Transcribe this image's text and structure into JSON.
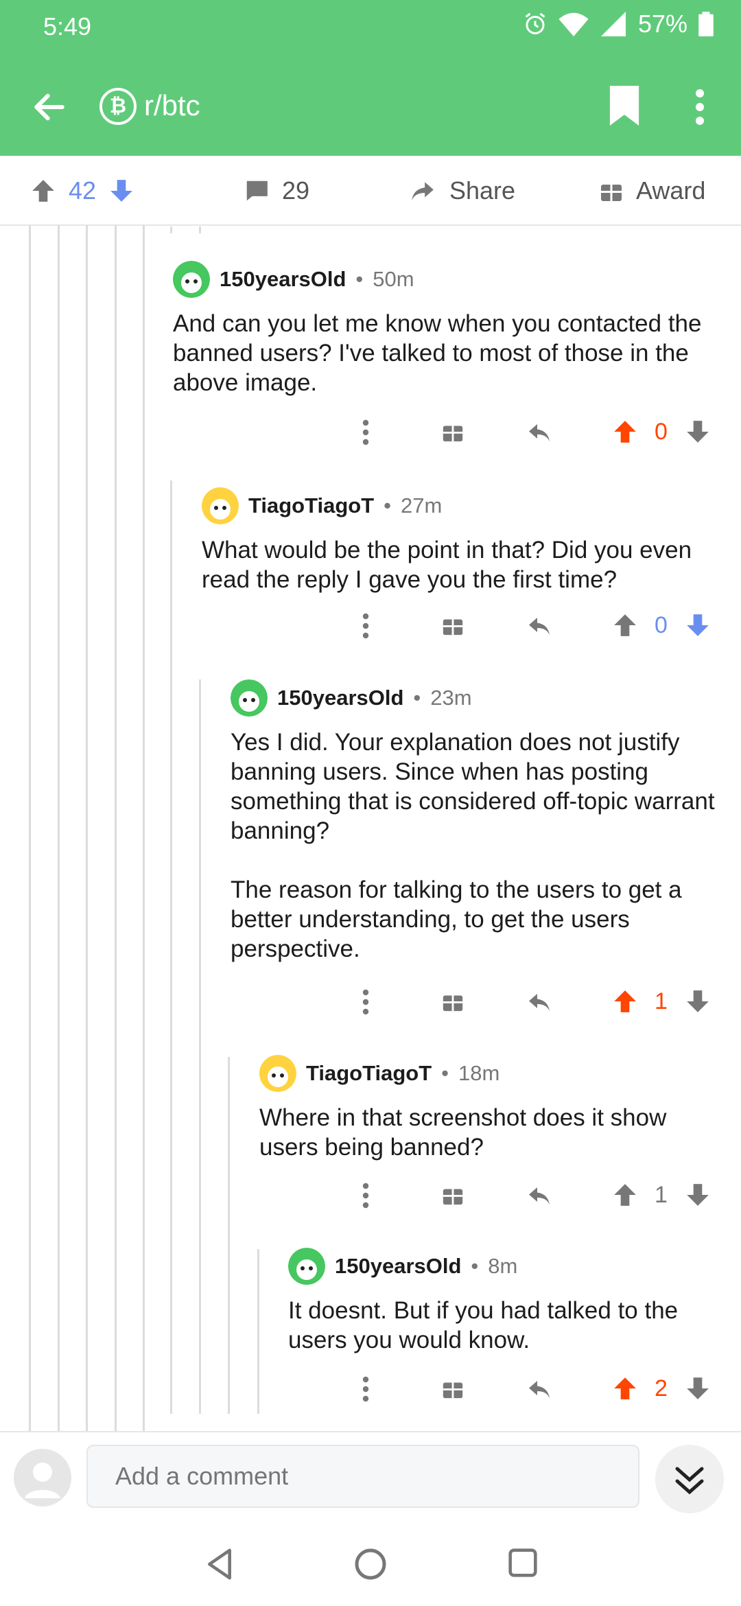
{
  "status": {
    "time": "5:49",
    "battery": "57%"
  },
  "appbar": {
    "subreddit": "r/btc",
    "sub_icon": "bitcoin-icon"
  },
  "post_actions": {
    "score": "42",
    "comments": "29",
    "share": "Share",
    "award": "Award"
  },
  "comments": [
    {
      "user": "150yearsOld",
      "sep": "•",
      "time": "50m",
      "body": "And can you let me know when you contacted the banned users? I've talked to most of those in the above image.",
      "score": "0",
      "vote": "up"
    },
    {
      "user": "TiagoTiagoT",
      "sep": "•",
      "time": "27m",
      "body": "What would be the point in that? Did you even read the reply I gave you the first time?",
      "score": "0",
      "vote": "down"
    },
    {
      "user": "150yearsOld",
      "sep": "•",
      "time": "23m",
      "body": "Yes I did. Your explanation does not justify banning users. Since when has posting something that is considered off-topic warrant banning?\n\nThe reason for talking to the users to get a better understanding, to get the users perspective.",
      "score": "1",
      "vote": "up"
    },
    {
      "user": "TiagoTiagoT",
      "sep": "•",
      "time": "18m",
      "body": "Where in that screenshot does it show users being banned?",
      "score": "1",
      "vote": "none"
    },
    {
      "user": "150yearsOld",
      "sep": "•",
      "time": "8m",
      "body": "It doesnt. But if you had talked to the users you would know.",
      "score": "2",
      "vote": "up"
    }
  ],
  "composer": {
    "placeholder": "Add a comment"
  },
  "colors": {
    "header": "#5fcb7a",
    "upvote": "#ff4500",
    "downvote": "#6a8ef0",
    "gray": "#777777"
  }
}
